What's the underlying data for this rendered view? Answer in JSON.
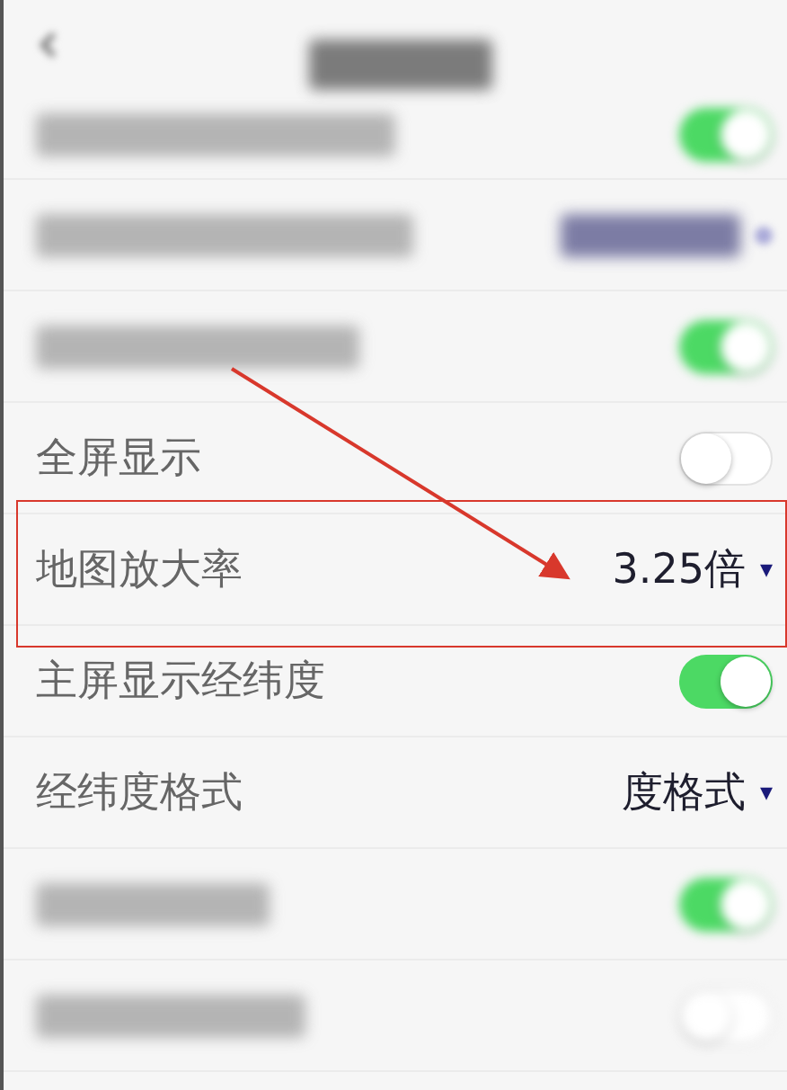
{
  "rows": [
    {
      "kind": "toggle",
      "on": true
    },
    {
      "kind": "select"
    },
    {
      "kind": "toggle",
      "on": true
    },
    {
      "kind": "toggle",
      "label": "全屏显示",
      "on": false
    },
    {
      "kind": "select",
      "label": "地图放大率",
      "value": "3.25倍",
      "caret": "▾",
      "highlighted": true
    },
    {
      "kind": "toggle",
      "label": "主屏显示经纬度",
      "on": true
    },
    {
      "kind": "select",
      "label": "经纬度格式",
      "value": "度格式",
      "caret": "▾"
    },
    {
      "kind": "toggle",
      "on": true
    },
    {
      "kind": "toggle",
      "on": false
    }
  ],
  "annotation_arrow": true
}
